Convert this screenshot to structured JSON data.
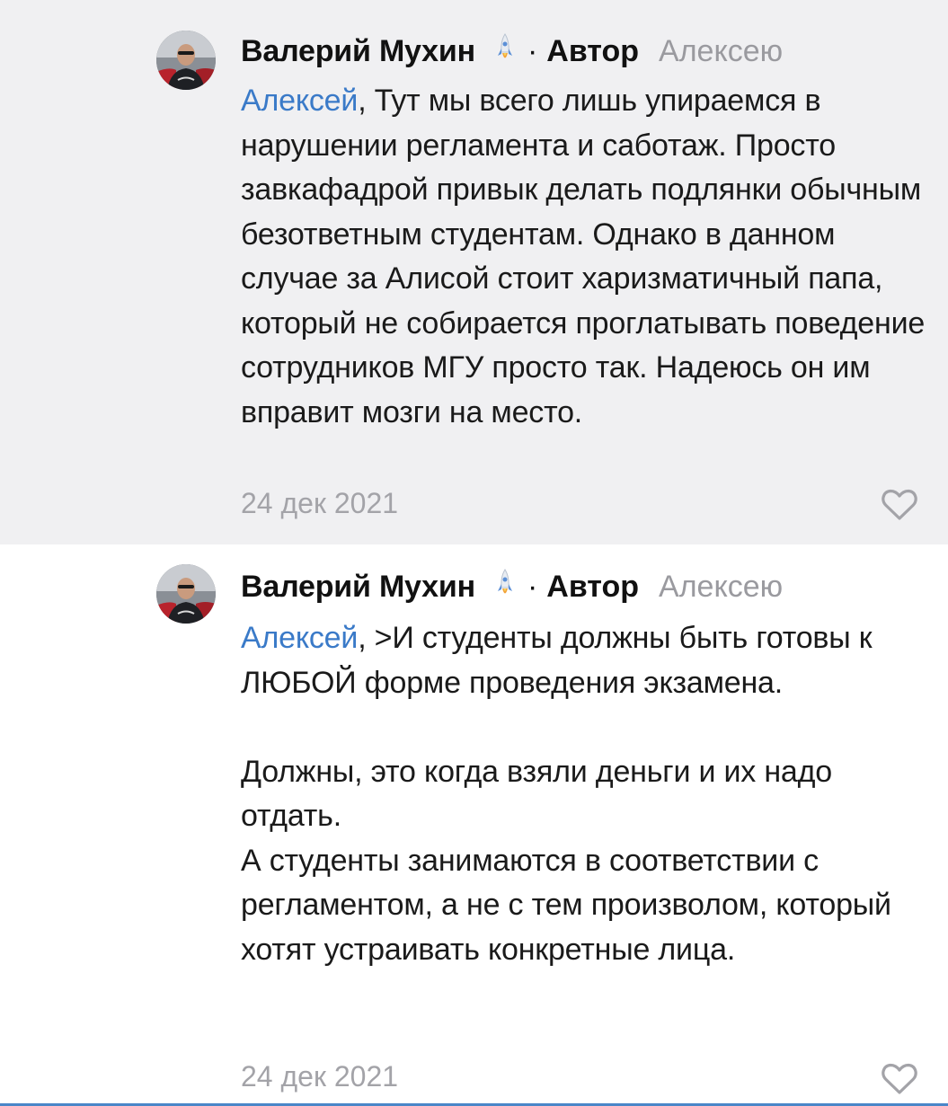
{
  "comments": [
    {
      "author": "Валерий Мухин",
      "role_dot": "·",
      "role": "Автор",
      "reply_to": "Алексею",
      "mention": "Алексей",
      "text_after_mention": ", Тут мы всего лишь упираемся в нарушении регламента и саботаж. Просто завкафадрой привык делать подлянки обычным безответным студентам. Однако в данном случае за Алисой стоит харизматичный папа, который не собирается проглатывать поведение сотрудников МГУ просто так. Надеюсь он им вправит мозги на место.",
      "date": "24 дек 2021",
      "like_icon": "heart-outline-icon"
    },
    {
      "author": "Валерий Мухин",
      "role_dot": "·",
      "role": "Автор",
      "reply_to": "Алексею",
      "mention": "Алексей",
      "text_after_mention": ", >И студенты должны быть готовы к ЛЮБОЙ форме проведения экзамена.",
      "paragraph_2": "Должны, это когда взяли деньги и их надо отдать.",
      "paragraph_3": "А студенты занимаются в соответствии с регламентом, а не с тем произволом, который хотят устраивать конкретные лица.",
      "date": "24 дек 2021",
      "like_icon": "heart-outline-icon"
    }
  ],
  "colors": {
    "highlight_bg": "#f0f0f2",
    "mention": "#3a7ac8",
    "muted": "#a3a3a8",
    "text": "#1a1a1a",
    "accent_line": "#4a86c8"
  }
}
